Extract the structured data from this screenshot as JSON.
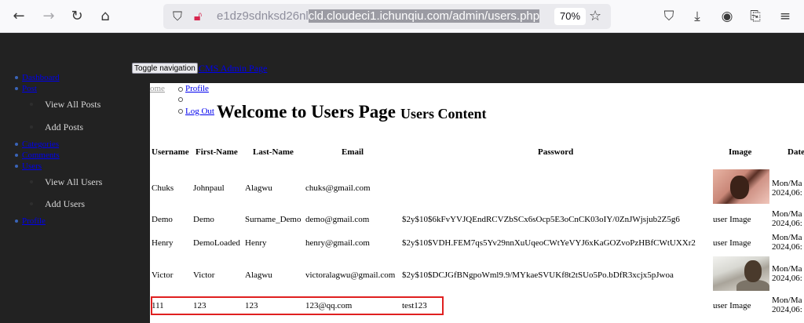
{
  "browser": {
    "url_prefix": "e1dz9sdnksd26nl",
    "url_selected": "cld.cloudeci1.ichunqiu.com/admin/users.php",
    "zoom": "70%"
  },
  "navbar": {
    "toggle_label": "Toggle navigation",
    "brand": "CMS Admin Page"
  },
  "sidebar": {
    "dashboard": "Dashboard",
    "post": "Post",
    "view_all_posts": "View All Posts",
    "add_posts": "Add Posts",
    "categories": "Categories",
    "comments": "Comments",
    "users": "Users",
    "view_all_users": "View All Users",
    "add_users": "Add Users",
    "profile": "Profile"
  },
  "topmenu": {
    "home": "ome",
    "profile": "Profile",
    "logout": "Log Out"
  },
  "page": {
    "title": "Welcome to Users Page",
    "subtitle": "Users Content"
  },
  "table": {
    "headers": {
      "username": "Username",
      "first_name": "First-Name",
      "last_name": "Last-Name",
      "email": "Email",
      "password": "Password",
      "image": "Image",
      "date": "Date"
    },
    "rows": [
      {
        "username": "Chuks",
        "first_name": "Johnpaul",
        "last_name": "Alagwu",
        "email": "chuks@gmail.com",
        "password": "",
        "image": "",
        "date_1": "Mon/Ma",
        "date_2": "2024,06:"
      },
      {
        "username": "Demo",
        "first_name": "Demo",
        "last_name": "Surname_Demo",
        "email": "demo@gmail.com",
        "password": "$2y$10$6kFvYVJQEndRCVZbSCx6sOcp5E3oCnCK03oIY/0ZnJWjsjub2Z5g6",
        "image": "user Image",
        "date_1": "Mon/Ma",
        "date_2": "2024,06:"
      },
      {
        "username": "Henry",
        "first_name": "DemoLoaded",
        "last_name": "Henry",
        "email": "henry@gmail.com",
        "password": "$2y$10$VDH.FEM7qs5Yv29nnXuUqeoCWtYeVYJ6xKaGOZvoPzHBfCWtUXXr2",
        "image": "user Image",
        "date_1": "Mon/Ma",
        "date_2": "2024,06:"
      },
      {
        "username": "Victor",
        "first_name": "Victor",
        "last_name": "Alagwu",
        "email": "victoralagwu@gmail.com",
        "password": "$2y$10$DCJGfBNgpoWml9.9/MYkaeSVUKf8t2tSUo5Po.bDfR3xcjx5pJwoa",
        "image": "",
        "date_1": "Mon/Ma",
        "date_2": "2024,06:"
      },
      {
        "username": "111",
        "first_name": "123",
        "last_name": "123",
        "email": "123@qq.com",
        "password": "test123",
        "image": "user Image",
        "date_1": "Mon/Ma",
        "date_2": "2024,06:"
      }
    ]
  },
  "colors": {
    "sidebar_bg": "#222222",
    "link": "#0000ee",
    "highlight_border": "#e02020"
  }
}
